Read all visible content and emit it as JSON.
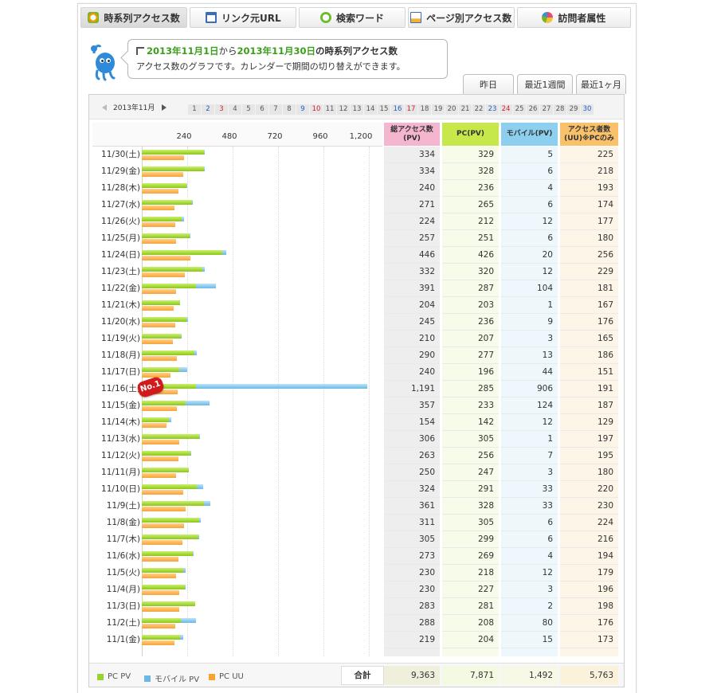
{
  "tabs": [
    {
      "label": "時系列アクセス数",
      "icon": "clock-icon",
      "active": true
    },
    {
      "label": "リンク元URL",
      "icon": "window-icon",
      "active": false
    },
    {
      "label": "検索ワード",
      "icon": "speech-bubble-icon",
      "active": false
    },
    {
      "label": "ページ別アクセス数",
      "icon": "page-icon",
      "active": false
    },
    {
      "label": "訪問者属性",
      "icon": "pie-icon",
      "active": false
    }
  ],
  "bubble": {
    "date_from": "2013年11月1日",
    "from_word": "から",
    "date_to": "2013年11月30日",
    "suffix": "の時系列アクセス数",
    "description": "アクセス数のグラフです。カレンダーで期間の切り替えができます。"
  },
  "period_buttons": [
    "昨日",
    "最近1週間",
    "最近1ヶ月"
  ],
  "calendar": {
    "month": "2013年11月",
    "days": [
      "1",
      "2",
      "3",
      "4",
      "5",
      "6",
      "7",
      "8",
      "9",
      "10",
      "11",
      "12",
      "13",
      "14",
      "15",
      "16",
      "17",
      "18",
      "19",
      "20",
      "21",
      "22",
      "23",
      "24",
      "25",
      "26",
      "27",
      "28",
      "29",
      "30"
    ],
    "saturdays": [
      "2",
      "9",
      "16",
      "23",
      "30"
    ],
    "sundays": [
      "3",
      "10",
      "17",
      "24"
    ]
  },
  "table": {
    "headers": {
      "total": "総アクセス数\n(PV)",
      "pc": "PC(PV)",
      "mobile": "モバイル(PV)",
      "uu": "アクセス者数\n(UU)※PCのみ"
    },
    "header_colors": {
      "total": "#f4b6cf",
      "pc": "#c6e84a",
      "mobile": "#8ccfef",
      "uu": "#f9c26a"
    }
  },
  "badge": "No.1",
  "footer": {
    "legend": [
      {
        "label": "PC PV",
        "color": "#9ad12a"
      },
      {
        "label": "モバイル PV",
        "color": "#6ab8e3"
      },
      {
        "label": "PC UU",
        "color": "#f8a236"
      }
    ],
    "total_label": "合計",
    "totals": {
      "total": "9,363",
      "pc": "7,871",
      "mobile": "1,492",
      "uu": "5,763"
    }
  },
  "chart_data": {
    "type": "bar",
    "orientation": "horizontal",
    "x_ticks": [
      "240",
      "480",
      "720",
      "960",
      "1,200"
    ],
    "xlim": [
      0,
      1200
    ],
    "categories": [
      "11/30(土)",
      "11/29(金)",
      "11/28(木)",
      "11/27(水)",
      "11/26(火)",
      "11/25(月)",
      "11/24(日)",
      "11/23(土)",
      "11/22(金)",
      "11/21(木)",
      "11/20(水)",
      "11/19(火)",
      "11/18(月)",
      "11/17(日)",
      "11/16(土)",
      "11/15(金)",
      "11/14(木)",
      "11/13(水)",
      "11/12(火)",
      "11/11(月)",
      "11/10(日)",
      "11/9(土)",
      "11/8(金)",
      "11/7(木)",
      "11/6(水)",
      "11/5(火)",
      "11/4(月)",
      "11/3(日)",
      "11/2(土)",
      "11/1(金)"
    ],
    "series": [
      {
        "name": "総アクセス数(PV)",
        "values": [
          334,
          334,
          240,
          271,
          224,
          257,
          446,
          332,
          391,
          204,
          245,
          210,
          290,
          240,
          1191,
          357,
          154,
          306,
          263,
          250,
          324,
          361,
          311,
          305,
          273,
          230,
          230,
          283,
          288,
          219
        ]
      },
      {
        "name": "PC(PV)",
        "values": [
          329,
          328,
          236,
          265,
          212,
          251,
          426,
          320,
          287,
          203,
          236,
          207,
          277,
          196,
          285,
          233,
          142,
          305,
          256,
          247,
          291,
          328,
          305,
          299,
          269,
          218,
          227,
          281,
          208,
          204
        ]
      },
      {
        "name": "モバイル(PV)",
        "values": [
          5,
          6,
          4,
          6,
          12,
          6,
          20,
          12,
          104,
          1,
          9,
          3,
          13,
          44,
          906,
          124,
          12,
          1,
          7,
          3,
          33,
          33,
          6,
          6,
          4,
          12,
          3,
          2,
          80,
          15
        ]
      },
      {
        "name": "アクセス者数(UU)※PCのみ",
        "values": [
          225,
          218,
          193,
          174,
          177,
          180,
          256,
          229,
          181,
          167,
          176,
          165,
          186,
          151,
          191,
          187,
          129,
          197,
          195,
          180,
          220,
          230,
          224,
          216,
          194,
          179,
          196,
          198,
          176,
          173
        ]
      }
    ],
    "display_values": {
      "total": [
        "334",
        "334",
        "240",
        "271",
        "224",
        "257",
        "446",
        "332",
        "391",
        "204",
        "245",
        "210",
        "290",
        "240",
        "1,191",
        "357",
        "154",
        "306",
        "263",
        "250",
        "324",
        "361",
        "311",
        "305",
        "273",
        "230",
        "230",
        "283",
        "288",
        "219"
      ]
    }
  }
}
